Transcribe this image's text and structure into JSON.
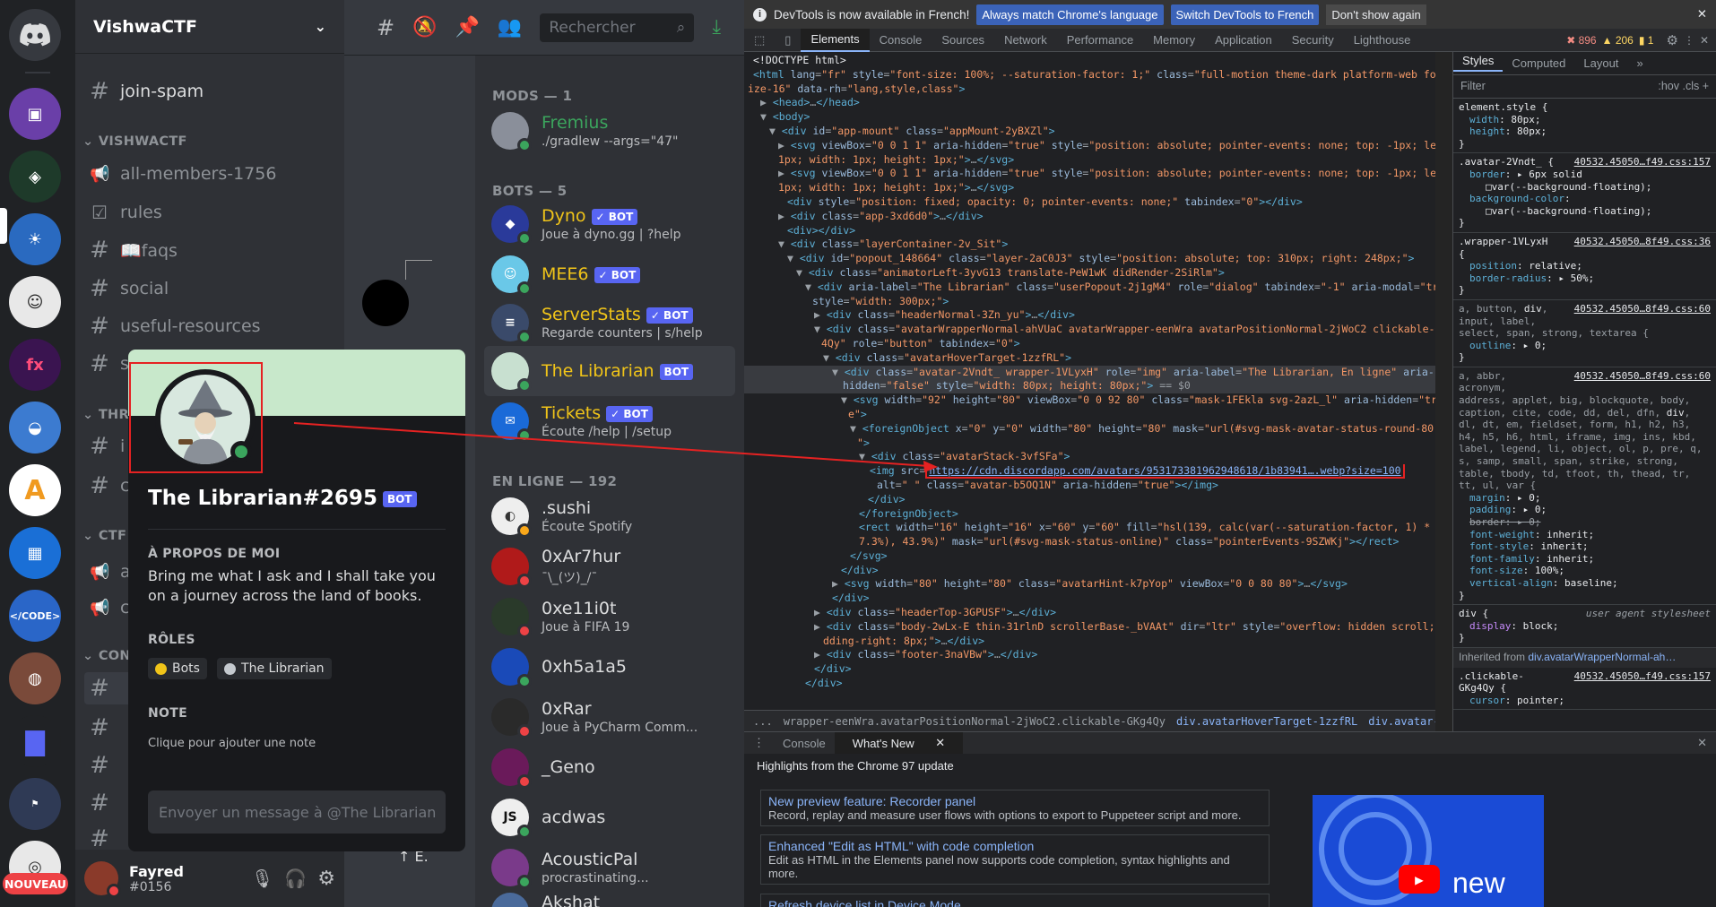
{
  "guilds": {
    "new_badge": "NOUVEAU"
  },
  "server": {
    "name": "VishwaCTF",
    "categories": [
      "VISHWACTF",
      "THREA",
      "CTF U",
      "CONV"
    ],
    "channels": [
      {
        "name": "join-spam",
        "icon": "hash"
      },
      {
        "name": "all-members-1756",
        "icon": "megaphone"
      },
      {
        "name": "rules",
        "icon": "checkbox"
      },
      {
        "name": "📖faqs",
        "icon": "hash"
      },
      {
        "name": "social",
        "icon": "hash"
      },
      {
        "name": "useful-resources",
        "icon": "hash"
      }
    ]
  },
  "user_panel": {
    "name": "Fayred",
    "tag": "#0156"
  },
  "toolbar": {
    "search_placeholder": "Rechercher"
  },
  "members": {
    "groups": [
      {
        "header": "MODS — 1"
      },
      {
        "header": "BOTS — 5"
      },
      {
        "header": "EN LIGNE — 192"
      }
    ],
    "mods": [
      {
        "name": "Fremius",
        "sub": "./gradlew --args=\"47\"",
        "color": "#3ba55d"
      }
    ],
    "bots": [
      {
        "name": "Dyno",
        "sub": "Joue à dyno.gg | ?help",
        "badge": "✓ BOT",
        "color": "#f0c419"
      },
      {
        "name": "MEE6",
        "sub": "",
        "badge": "✓ BOT",
        "color": "#f0c419"
      },
      {
        "name": "ServerStats",
        "sub": "Regarde counters | s/help",
        "badge": "✓ BOT",
        "color": "#f0c419"
      },
      {
        "name": "The Librarian",
        "sub": "",
        "badge": "BOT",
        "color": "#f0c419"
      },
      {
        "name": "Tickets",
        "sub": "Écoute /help | /setup",
        "badge": "✓ BOT",
        "color": "#f0c419"
      }
    ],
    "online": [
      {
        "name": ".sushi",
        "sub": "Écoute Spotify"
      },
      {
        "name": "0xAr7hur",
        "sub": "¯\\_(ツ)_/¯"
      },
      {
        "name": "0xe11i0t",
        "sub": "Joue à FIFA 19"
      },
      {
        "name": "0xh5a1a5",
        "sub": ""
      },
      {
        "name": "0xRar",
        "sub": "Joue à PyCharm Comm..."
      },
      {
        "name": "_Geno",
        "sub": ""
      },
      {
        "name": "acdwas",
        "sub": ""
      },
      {
        "name": "AcousticPal",
        "sub": "procrastinating..."
      },
      {
        "name": "Akshat",
        "sub": ""
      }
    ]
  },
  "popout": {
    "username": "The Librarian#2695",
    "badge": "BOT",
    "about_header": "À PROPOS DE MOI",
    "about_text": "Bring me what I ask and I shall take you on a journey across the land of books.",
    "roles_header": "RÔLES",
    "roles": [
      {
        "name": "Bots",
        "color": "#f0c419"
      },
      {
        "name": "The Librarian",
        "color": "#c4c9ce"
      }
    ],
    "note_header": "NOTE",
    "note_placeholder": "Clique pour ajouter une note",
    "message_placeholder": "Envoyer un message à @The Librarian"
  },
  "devtools": {
    "infobar": {
      "text": "DevTools is now available in French!",
      "btn1": "Always match Chrome's language",
      "btn2": "Switch DevTools to French",
      "btn3": "Don't show again"
    },
    "tabs": [
      "Elements",
      "Console",
      "Sources",
      "Network",
      "Performance",
      "Memory",
      "Application",
      "Security",
      "Lighthouse"
    ],
    "counts": {
      "errors": "896",
      "warnings": "206",
      "info": "1"
    },
    "breadcrumbs": [
      "...",
      "wrapper-eenWra.avatarPositionNormal-2jWoC2.clickable-GKg4Qy",
      "div.avatarHoverTarget-1zzfRL",
      "div.avatar-2Vndt_.wrapper-1VLyxH",
      "..."
    ],
    "styles_tabs": [
      "Styles",
      "Computed",
      "Layout",
      "»"
    ],
    "filter_placeholder": "Filter",
    "filter_tools": ":hov  .cls  +",
    "drawer_tabs": [
      "Console",
      "What's New"
    ],
    "whats_new_header": "Highlights from the Chrome 97 update",
    "cards": [
      {
        "title": "New preview feature: Recorder panel",
        "desc": "Record, replay and measure user flows with options to export to Puppeteer script and more."
      },
      {
        "title": "Enhanced \"Edit as HTML\" with code completion",
        "desc": "Edit as HTML in the Elements panel now supports code completion, syntax highlights and more."
      },
      {
        "title": "Refresh device list in Device Mode",
        "desc": ""
      }
    ],
    "video_label": "new"
  }
}
